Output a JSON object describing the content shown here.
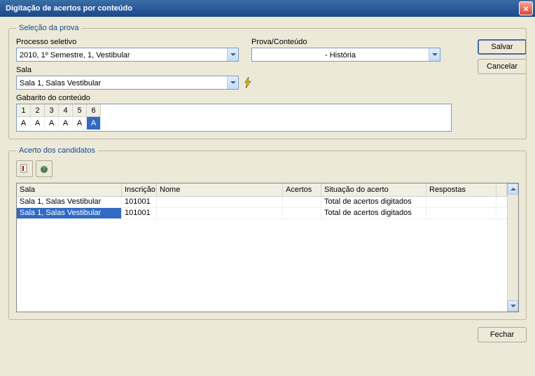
{
  "window": {
    "title": "Digitação de acertos por conteúdo"
  },
  "fieldset_selecao": {
    "legend": "Seleção da prova",
    "processo": {
      "label": "Processo seletivo",
      "value": "2010, 1º Semestre, 1, Vestibular"
    },
    "prova": {
      "label": "Prova/Conteúdo",
      "value": "  - História"
    },
    "sala": {
      "label": "Sala",
      "value": "Sala 1, Salas Vestibular"
    },
    "gabarito": {
      "label": "Gabarito do conteúdo",
      "cols": [
        "1",
        "2",
        "3",
        "4",
        "5",
        "6"
      ],
      "vals": [
        "A",
        "A",
        "A",
        "A",
        "A",
        "A"
      ],
      "selected_index": 5
    }
  },
  "fieldset_acerto": {
    "legend": "Acerto dos candidatos",
    "headers": {
      "sala": "Sala",
      "inscricao": "Inscrição",
      "nome": "Nome",
      "acertos": "Acertos",
      "situacao": "Situação do acerto",
      "respostas": "Respostas"
    },
    "rows": [
      {
        "sala": "Sala 1, Salas Vestibular",
        "inscricao": "101001",
        "nome": "",
        "acertos": "",
        "situacao": "Total de acertos digitados",
        "respostas": "",
        "selected": false
      },
      {
        "sala": "Sala 1, Salas Vestibular",
        "inscricao": "101001",
        "nome": "",
        "acertos": "",
        "situacao": "Total de acertos digitados",
        "respostas": "",
        "selected": true
      }
    ]
  },
  "buttons": {
    "salvar": "Salvar",
    "cancelar": "Cancelar",
    "fechar": "Fechar"
  },
  "grid_widths": {
    "sala": 150,
    "inscricao": 50,
    "nome": 180,
    "acertos": 55,
    "situacao": 150,
    "respostas": 100
  }
}
